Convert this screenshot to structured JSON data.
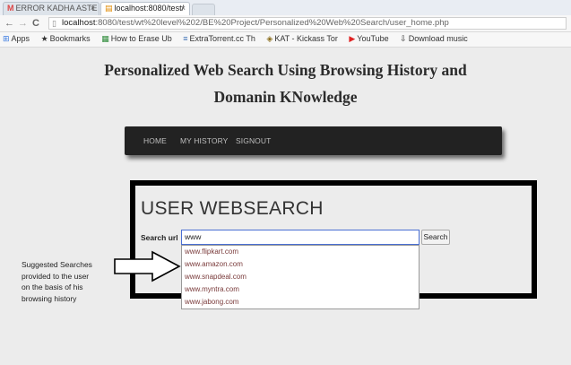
{
  "browser": {
    "tabs": [
      {
        "label": "ERROR KADHA ASTE",
        "favicon": "M",
        "active": false
      },
      {
        "label": "localhost:8080/test/",
        "favicon": "▤",
        "active": true
      }
    ],
    "url_host": "localhost",
    "url_path": ":8080/test/wt%20level%202/BE%20Project/Personalized%20Web%20Search/user_home.php",
    "bookmarks": [
      {
        "icon": "apps-icon",
        "glyph": "⊞",
        "label": "Apps"
      },
      {
        "icon": "star-icon",
        "glyph": "★",
        "label": "Bookmarks"
      },
      {
        "icon": "page-icon",
        "glyph": "▦",
        "label": "How to Erase Ub"
      },
      {
        "icon": "torrent-icon",
        "glyph": "≡",
        "label": "ExtraTorrent.cc Th"
      },
      {
        "icon": "kat-icon",
        "glyph": "◈",
        "label": "KAT - Kickass Tor"
      },
      {
        "icon": "youtube-icon",
        "glyph": "▶",
        "label": "YouTube"
      },
      {
        "icon": "download-icon",
        "glyph": "⇩",
        "label": "Download music"
      }
    ]
  },
  "page": {
    "title_line1": "Personalized Web Search Using Browsing History and",
    "title_line2": "Domanin KNowledge",
    "nav": {
      "home": "HOME",
      "history": "MY HISTORY",
      "signout": "SIGNOUT"
    },
    "search": {
      "heading": "USER WEBSEARCH",
      "label": "Search url",
      "value": "www",
      "button": "Search",
      "suggestions": [
        "www.flipkart.com",
        "www.amazon.com",
        "www.snapdeal.com",
        "www.myntra.com",
        "www.jabong.com"
      ]
    },
    "annotation": [
      "Suggested Searches",
      "provided to the user",
      "on the basis of his",
      "browsing history"
    ]
  },
  "colors": {
    "navbar": "#222222",
    "page_bg": "#ececec",
    "suggestion_text": "#7a3b3b",
    "input_focus_border": "#4a6fd3"
  }
}
